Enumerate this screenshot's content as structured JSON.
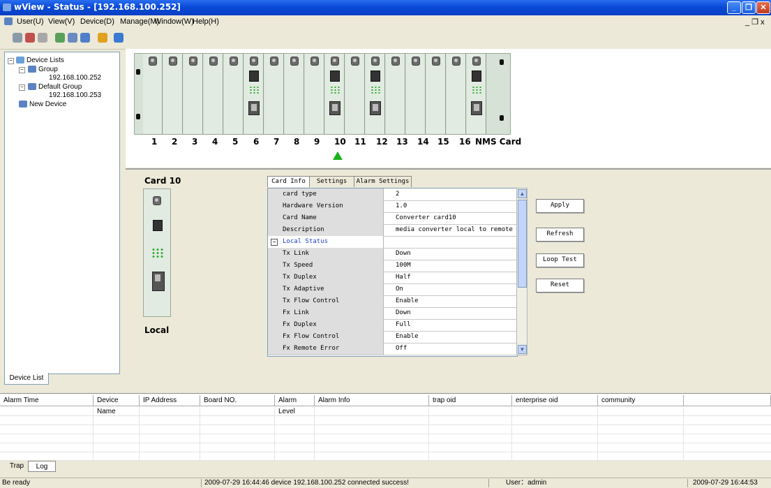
{
  "window": {
    "title": "wView - Status - [192.168.100.252]",
    "minimize": "_",
    "maximize": "❐",
    "close": "✕",
    "mdi_controls": "_ ❐ x"
  },
  "menu": [
    "User(U)",
    "View(V)",
    "Device(D)",
    "Manage(M)",
    "Window(W)",
    "Help(H)"
  ],
  "tree": {
    "root": "Device Lists",
    "groups": [
      {
        "name": "Group",
        "ip": "192.168.100.252"
      },
      {
        "name": "Default Group",
        "ip": "192.168.100.253"
      }
    ],
    "new_device": "New Device",
    "expand_sign": "−"
  },
  "device_list_tab": "Device List",
  "chassis": {
    "slot_labels": [
      "1",
      "2",
      "3",
      "4",
      "5",
      "6",
      "7",
      "8",
      "9",
      "10",
      "11",
      "12",
      "13",
      "14",
      "15",
      "16",
      "NMS Card"
    ],
    "populated_slots": [
      6,
      10,
      12,
      17
    ],
    "selected_slot": "10"
  },
  "card": {
    "title": "Card 10",
    "side_label": "Local",
    "tabs": [
      "Card Info",
      "Settings",
      "Alarm Settings"
    ],
    "active_tab": "Card Info",
    "rows": [
      {
        "key": "card type",
        "value": "2"
      },
      {
        "key": "Hardware Version",
        "value": "1.0"
      },
      {
        "key": "Card Name",
        "value": "Converter card10"
      },
      {
        "key": "Description",
        "value": "media converter local to remote"
      },
      {
        "key": "Local Status",
        "value": "",
        "section": true
      },
      {
        "key": "Tx Link",
        "value": "Down"
      },
      {
        "key": "Tx Speed",
        "value": "100M"
      },
      {
        "key": "Tx Duplex",
        "value": "Half"
      },
      {
        "key": "Tx Adaptive",
        "value": "On"
      },
      {
        "key": "Tx Flow Control",
        "value": "Enable"
      },
      {
        "key": "Fx Link",
        "value": "Down"
      },
      {
        "key": "Fx Duplex",
        "value": "Full"
      },
      {
        "key": "Fx Flow Control",
        "value": "Enable"
      },
      {
        "key": "Fx Remote Error",
        "value": "Off"
      }
    ],
    "buttons": [
      "Apply",
      "Refresh",
      "Loop Test",
      "Reset"
    ]
  },
  "alarm_table": {
    "columns": [
      "Alarm Time",
      "Device Name",
      "IP Address",
      "Board NO.",
      "Alarm Level",
      "Alarm Info",
      "trap oid",
      "enterprise oid",
      "community"
    ],
    "rows": []
  },
  "bottom_tabs": [
    "Trap",
    "Log"
  ],
  "status": {
    "ready": "Be ready",
    "message": "2009-07-29 16:44:46 device 192.168.100.252 connected success!",
    "user": "User：admin",
    "time": "2009-07-29 16:44:53"
  },
  "colors": {
    "title_blue": "#0a4ad8",
    "led_green": "#2ea82e",
    "marker_green": "#1bb01b",
    "section_text": "#1f3cc8"
  }
}
